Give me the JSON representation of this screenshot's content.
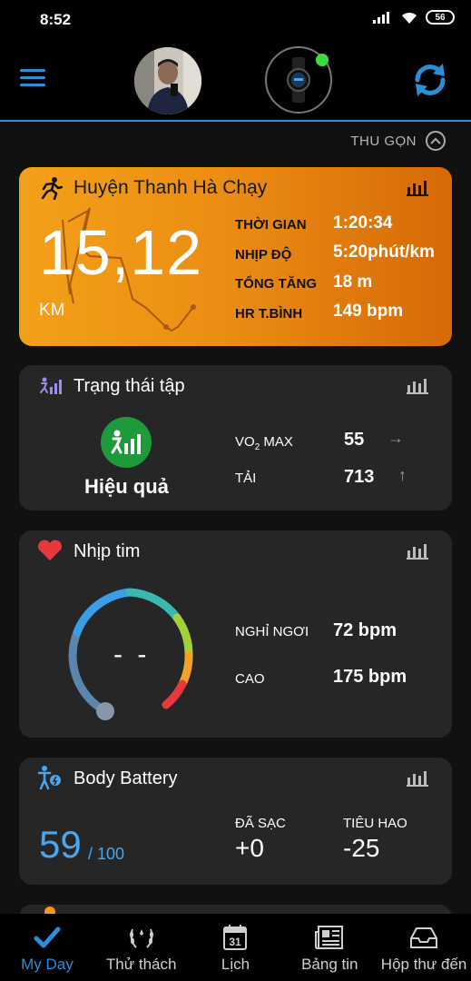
{
  "status_bar": {
    "time": "8:52",
    "battery": "56"
  },
  "header": {
    "menu_icon": "hamburger-menu-icon",
    "avatar": "user-avatar",
    "device": "watch-icon",
    "sync_icon": "sync-icon"
  },
  "collapse": {
    "label": "THU GỌN",
    "icon": "chevron-up-icon"
  },
  "activity": {
    "title": "Huyện Thanh Hà Chạy",
    "distance": "15,12",
    "unit": "KM",
    "stats": [
      {
        "label": "THỜI GIAN",
        "value": "1:20:34"
      },
      {
        "label": "NHỊP ĐỘ",
        "value": "5:20phút/km"
      },
      {
        "label": "TỔNG TĂNG",
        "value": "18 m"
      },
      {
        "label": "HR T.BÌNH",
        "value": "149 bpm"
      }
    ],
    "colors": {
      "start": "#f3a019",
      "end": "#d66a06"
    }
  },
  "training": {
    "title": "Trạng thái tập",
    "status": "Hiệu quả",
    "vo2_label_pre": "VO",
    "vo2_label_sub": "2",
    "vo2_label_post": " MAX",
    "vo2_value": "55",
    "vo2_trend": "→",
    "load_label": "TẢI",
    "load_value": "713",
    "load_trend": "↑",
    "status_color": "#1f9a3a"
  },
  "heart": {
    "title": "Nhịp tim",
    "current": "- -",
    "rest_label": "NGHỈ NGƠI",
    "rest_value": "72 bpm",
    "high_label": "CAO",
    "high_value": "175 bpm",
    "icon_color": "#e8383d"
  },
  "body_battery": {
    "title": "Body Battery",
    "value": "59",
    "max": "/ 100",
    "charged_label": "ĐÃ SẠC",
    "charged_value": "+0",
    "drained_label": "TIÊU HAO",
    "drained_value": "-25",
    "accent": "#4aa6ee"
  },
  "nav": {
    "items": [
      {
        "label": "My Day",
        "icon": "checkmark-icon",
        "active": true
      },
      {
        "label": "Thử thách",
        "icon": "laurel-icon",
        "active": false
      },
      {
        "label": "Lịch",
        "icon": "calendar-icon",
        "day": "31",
        "active": false
      },
      {
        "label": "Bảng tin",
        "icon": "newsfeed-icon",
        "active": false
      },
      {
        "label": "Hộp thư đến",
        "icon": "inbox-icon",
        "active": false
      }
    ]
  }
}
